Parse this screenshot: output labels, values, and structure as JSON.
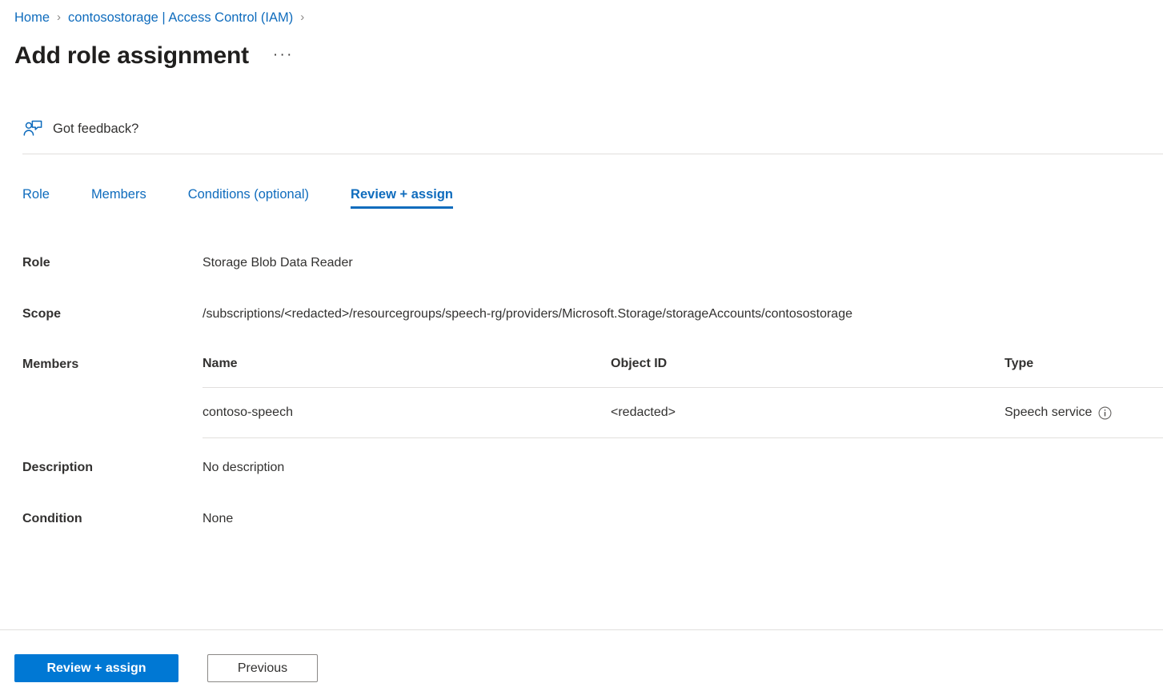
{
  "breadcrumb": {
    "items": [
      {
        "label": "Home"
      },
      {
        "label": "contosostorage | Access Control (IAM)"
      }
    ],
    "separator": "›"
  },
  "header": {
    "title": "Add role assignment",
    "more_label": "···"
  },
  "feedback": {
    "label": "Got feedback?",
    "icon": "person-feedback-icon"
  },
  "tabs": [
    {
      "label": "Role",
      "active": false
    },
    {
      "label": "Members",
      "active": false
    },
    {
      "label": "Conditions (optional)",
      "active": false
    },
    {
      "label": "Review + assign",
      "active": true
    }
  ],
  "fields": {
    "role": {
      "label": "Role",
      "value": "Storage Blob Data Reader"
    },
    "scope": {
      "label": "Scope",
      "value": "/subscriptions/<redacted>/resourcegroups/speech-rg/providers/Microsoft.Storage/storageAccounts/contosostorage"
    },
    "members": {
      "label": "Members"
    },
    "description": {
      "label": "Description",
      "value": "No description"
    },
    "condition": {
      "label": "Condition",
      "value": "None"
    }
  },
  "members_table": {
    "columns": [
      {
        "key": "name",
        "label": "Name"
      },
      {
        "key": "object_id",
        "label": "Object ID"
      },
      {
        "key": "type",
        "label": "Type"
      }
    ],
    "rows": [
      {
        "name": "contoso-speech",
        "object_id": "<redacted>",
        "type": "Speech service",
        "type_info_icon": "info-icon"
      }
    ]
  },
  "footer": {
    "primary_label": "Review + assign",
    "secondary_label": "Previous"
  },
  "colors": {
    "accent": "#0078d4",
    "link": "#0f6cbd",
    "text": "#323130",
    "border": "#e1dfdd",
    "background": "#ffffff"
  }
}
